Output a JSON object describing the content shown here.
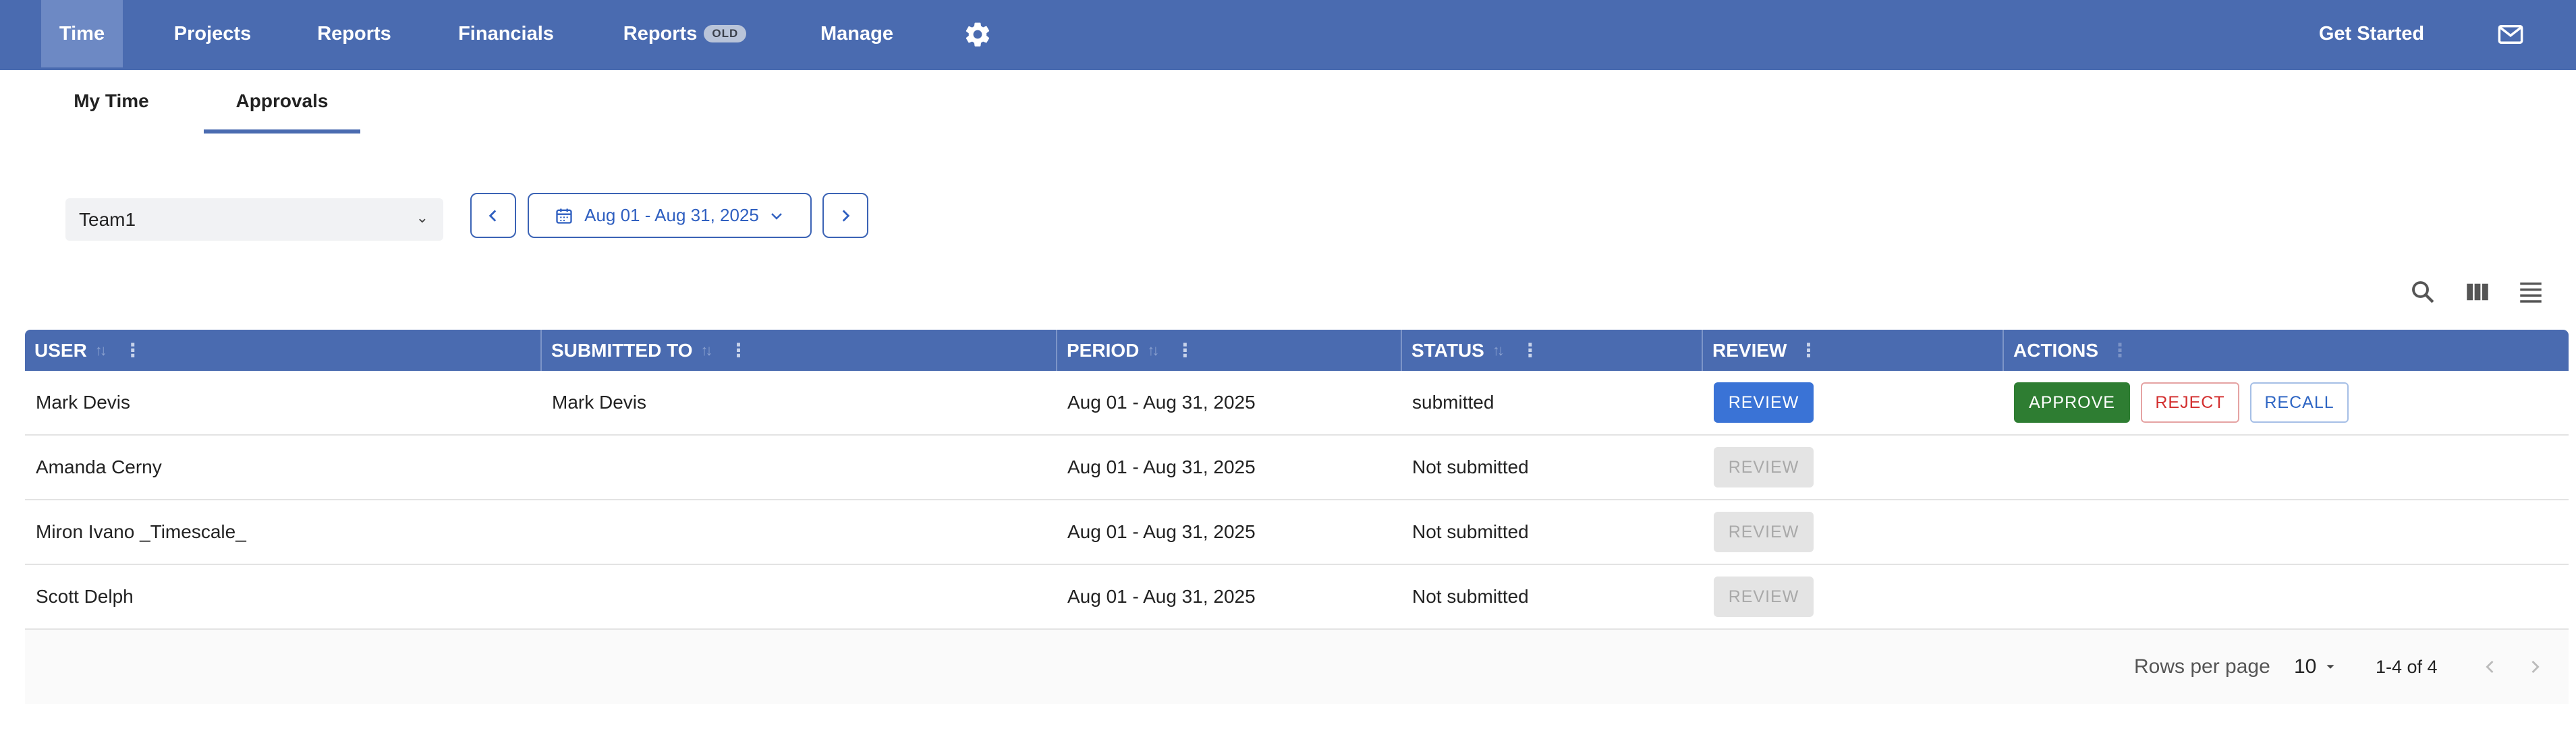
{
  "nav": {
    "items": [
      {
        "label": "Time",
        "badge": ""
      },
      {
        "label": "Projects",
        "badge": ""
      },
      {
        "label": "Reports",
        "badge": ""
      },
      {
        "label": "Financials",
        "badge": ""
      },
      {
        "label": "Reports",
        "badge": "OLD"
      },
      {
        "label": "Manage",
        "badge": ""
      }
    ],
    "settings_icon": "gear-icon",
    "get_started": "Get Started",
    "mail_icon": "mail-icon",
    "bg_color": "#4a6bb0"
  },
  "tabs": [
    {
      "label": "My Time"
    },
    {
      "label": "Approvals"
    }
  ],
  "filters": {
    "team": "Team1",
    "date_range": "Aug 01 - Aug 31, 2025"
  },
  "table": {
    "columns": [
      "USER",
      "SUBMITTED TO",
      "PERIOD",
      "STATUS",
      "REVIEW",
      "ACTIONS"
    ],
    "rows": [
      {
        "user": "Mark Devis",
        "submitted_to": "Mark Devis",
        "period": "Aug 01 - Aug 31, 2025",
        "status": "submitted",
        "review": "REVIEW",
        "review_enabled": true,
        "actions": [
          "APPROVE",
          "REJECT",
          "RECALL"
        ]
      },
      {
        "user": "Amanda Cerny",
        "submitted_to": "",
        "period": "Aug 01 - Aug 31, 2025",
        "status": "Not submitted",
        "review": "REVIEW",
        "review_enabled": false,
        "actions": []
      },
      {
        "user": "Miron Ivano _Timescale_",
        "submitted_to": "",
        "period": "Aug 01 - Aug 31, 2025",
        "status": "Not submitted",
        "review": "REVIEW",
        "review_enabled": false,
        "actions": []
      },
      {
        "user": "Scott Delph",
        "submitted_to": "",
        "period": "Aug 01 - Aug 31, 2025",
        "status": "Not submitted",
        "review": "REVIEW",
        "review_enabled": false,
        "actions": []
      }
    ]
  },
  "pagination": {
    "rows_per_page_label": "Rows per page",
    "rows_per_page": "10",
    "range": "1-4 of 4"
  },
  "colors": {
    "header": "#4a6bb0",
    "review": "#3a73d6",
    "approve": "#2e7d32",
    "reject": "#d32f2f",
    "recall": "#2f66c4"
  }
}
